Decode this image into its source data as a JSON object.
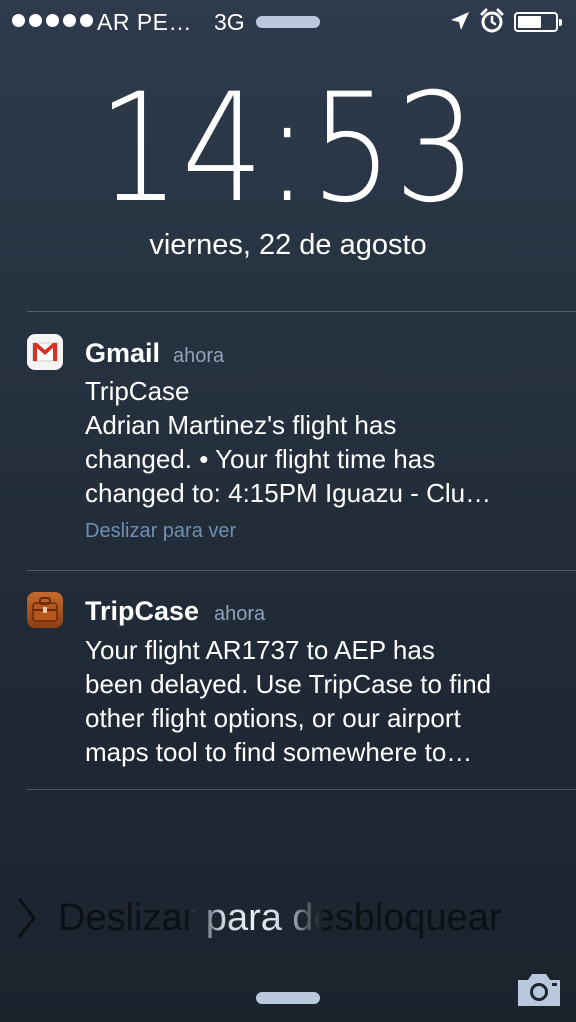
{
  "status_bar": {
    "signal_dots": 5,
    "carrier": "AR PE…",
    "network": "3G",
    "battery_level": 0.65
  },
  "lock_screen": {
    "time": "14:53",
    "date": "viernes, 22 de agosto"
  },
  "notifications": [
    {
      "app": "Gmail",
      "time": "ahora",
      "icon": "gmail-icon",
      "lines": [
        "TripCase",
        "Adrian  Martinez's flight has",
        "changed. • Your flight time has",
        "changed to: 4:15PM Iguazu - Clu…"
      ],
      "action": "Deslizar para ver"
    },
    {
      "app": "TripCase",
      "time": "ahora",
      "icon": "tripcase-icon",
      "lines": [
        "Your flight AR1737 to AEP has",
        "been delayed. Use TripCase to find",
        "other flight options, or our airport",
        "maps tool to find somewhere to…"
      ]
    }
  ],
  "unlock": {
    "label": "Deslizar para desbloquear"
  },
  "colors": {
    "background_top": "#2f3b4c",
    "background_bottom": "#1b232d",
    "secondary_text": "#8fa1b9",
    "action_text": "#6f8fb0"
  }
}
